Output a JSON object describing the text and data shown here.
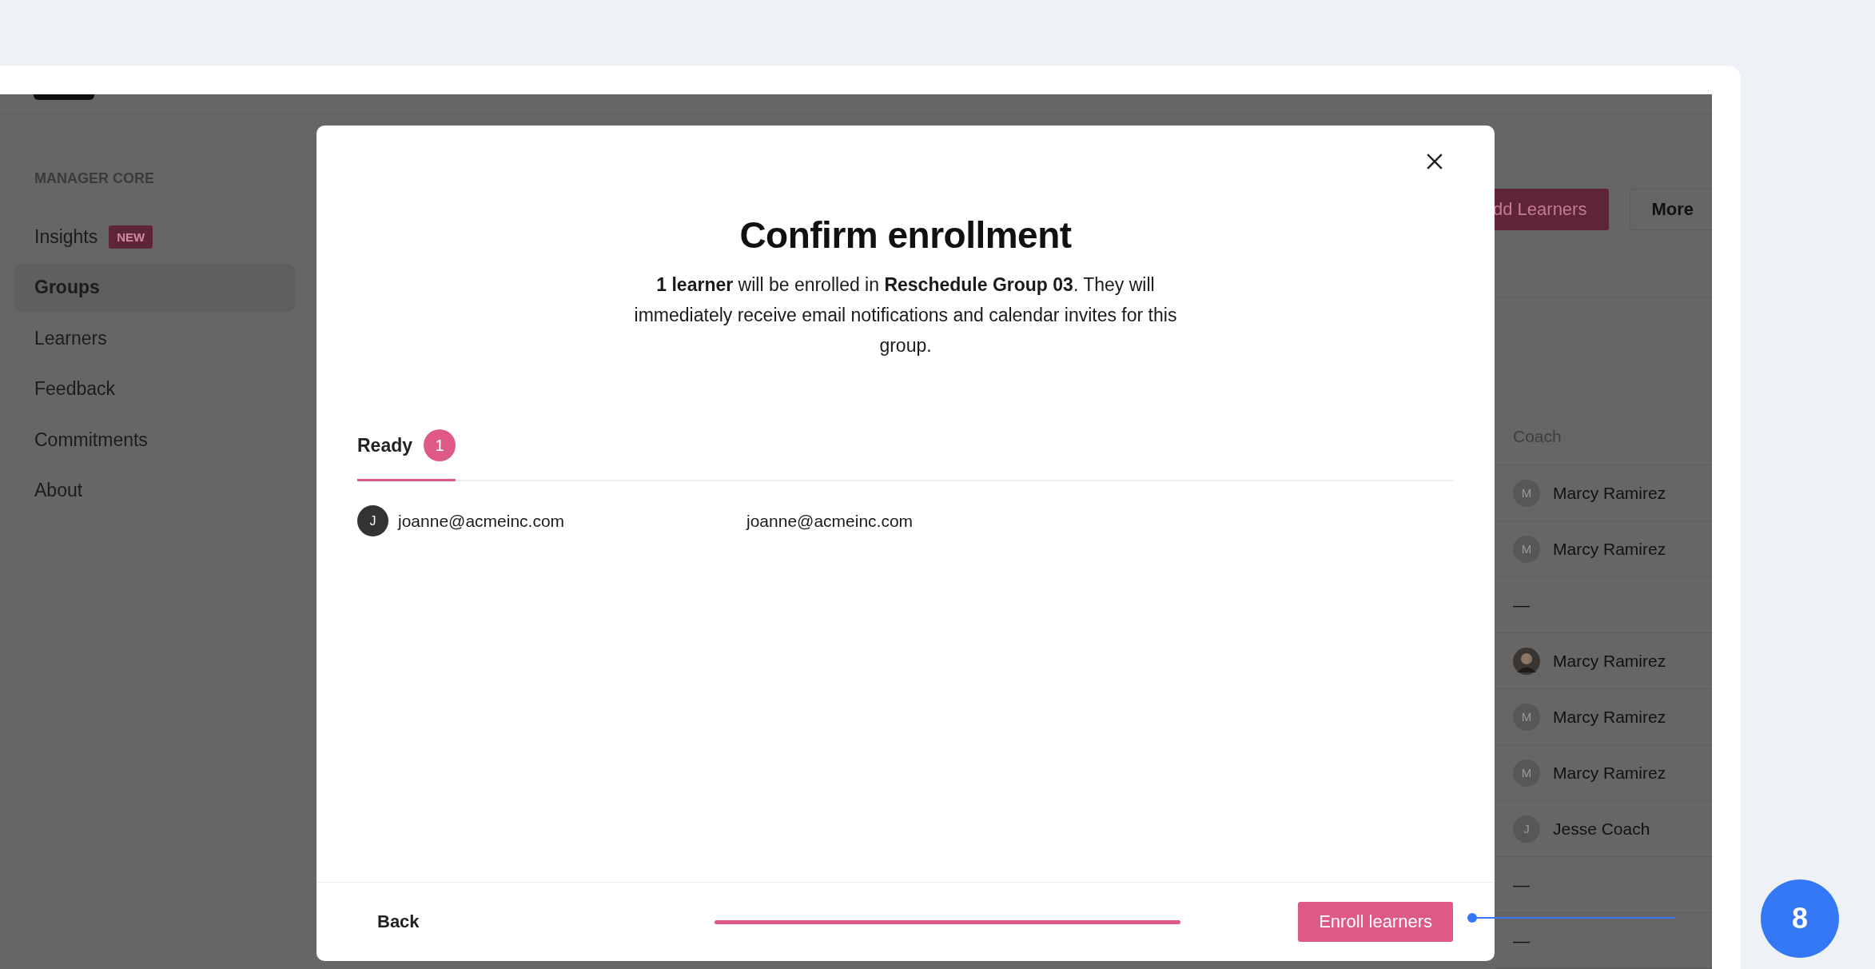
{
  "sidebar": {
    "section_title": "MANAGER CORE",
    "items": [
      {
        "label": "Insights",
        "badge": "NEW",
        "selected": false
      },
      {
        "label": "Groups",
        "selected": true
      },
      {
        "label": "Learners",
        "selected": false
      },
      {
        "label": "Feedback",
        "selected": false
      },
      {
        "label": "Commitments",
        "selected": false
      },
      {
        "label": "About",
        "selected": false
      }
    ]
  },
  "header_buttons": [
    {
      "label": "dd Learners",
      "kind": "primary"
    },
    {
      "label": "More",
      "kind": "secondary"
    }
  ],
  "table": {
    "columns": [
      "Coach"
    ],
    "rows": [
      {
        "coach": "Marcy Ramirez",
        "avatar": {
          "kind": "initial",
          "initial": "M"
        }
      },
      {
        "coach": "Marcy Ramirez",
        "avatar": {
          "kind": "initial",
          "initial": "M"
        }
      },
      {
        "coach": "—",
        "avatar": {
          "kind": "none"
        }
      },
      {
        "coach": "Marcy Ramirez",
        "avatar": {
          "kind": "photo"
        }
      },
      {
        "coach": "Marcy Ramirez",
        "avatar": {
          "kind": "initial",
          "initial": "M"
        }
      },
      {
        "coach": "Marcy Ramirez",
        "avatar": {
          "kind": "initial",
          "initial": "M"
        }
      },
      {
        "coach": "Jesse Coach",
        "avatar": {
          "kind": "initial",
          "initial": "J"
        }
      },
      {
        "coach": "—",
        "avatar": {
          "kind": "none"
        }
      },
      {
        "coach": "—",
        "avatar": {
          "kind": "none"
        }
      }
    ]
  },
  "modal": {
    "title": "Confirm enrollment",
    "description": "**1 learner** will be enrolled in **Reschedule Group 03**.  They will immediately receive email notifications and calendar invites for this group.",
    "tabs": [
      {
        "label": "Ready",
        "count": "1",
        "selected": true
      }
    ],
    "learners": [
      {
        "initial": "J",
        "name": "joanne@acmeinc.com",
        "email": "joanne@acmeinc.com"
      }
    ],
    "back_button": "Back",
    "progress": {
      "level": 1
    },
    "primary_button": "Enroll learners"
  },
  "annotation": {
    "marker": "8"
  }
}
